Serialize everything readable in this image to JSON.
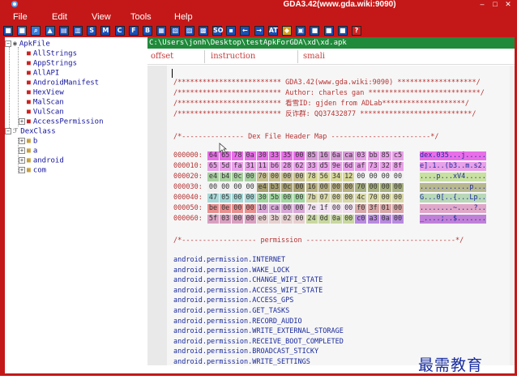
{
  "window": {
    "title": "GDA3.42(www.gda.wiki:9090)",
    "min_glyph": "–",
    "max_glyph": "□",
    "close_glyph": "✕"
  },
  "menu": [
    "File",
    "Edit",
    "View",
    "Tools",
    "Help"
  ],
  "toolbar": {
    "buttons": [
      {
        "glyph": "■",
        "color": "#1a4fb8"
      },
      {
        "glyph": "■",
        "color": "#3a7ad8"
      },
      {
        "glyph": "⌕",
        "color": "#3a7ad8"
      },
      {
        "glyph": "▲",
        "color": "#2a6ac8"
      },
      {
        "glyph": "▤",
        "color": "#1a4fb8"
      },
      {
        "glyph": "▥",
        "color": "#1a4fb8"
      },
      {
        "glyph": "S",
        "color": "#1a4fb8"
      },
      {
        "glyph": "M",
        "color": "#1a4fb8"
      },
      {
        "glyph": "C",
        "color": "#1a4fb8"
      },
      {
        "glyph": "F",
        "color": "#1a4fb8"
      },
      {
        "glyph": "B",
        "color": "#1a4fb8"
      },
      {
        "glyph": "▦",
        "color": "#1a4fb8"
      },
      {
        "glyph": "▧",
        "color": "#1a4fb8"
      },
      {
        "glyph": "▨",
        "color": "#1a4fb8"
      },
      {
        "glyph": "▩",
        "color": "#1a4fb8"
      },
      {
        "glyph": "SO",
        "color": "#1a4fb8"
      },
      {
        "glyph": "▪",
        "color": "#1a4fb8"
      },
      {
        "glyph": "←",
        "color": "#1a4fb8"
      },
      {
        "glyph": "→",
        "color": "#1a4fb8"
      },
      {
        "glyph": "AT",
        "color": "#1a4fb8"
      },
      {
        "glyph": "◆",
        "color": "#d8a018"
      },
      {
        "glyph": "▣",
        "color": "#1a4fb8"
      },
      {
        "glyph": "■",
        "color": "#1a4fb8"
      },
      {
        "glyph": "■",
        "color": "#1a4fb8"
      },
      {
        "glyph": "■",
        "color": "#1a4fb8"
      },
      {
        "glyph": "?",
        "color": "#d82020"
      }
    ]
  },
  "tree": {
    "root_apk": "ApkFile",
    "apk_children": [
      "AllStrings",
      "AppStrings",
      "AllAPI",
      "AndroidManifest",
      "HexView",
      "MalScan",
      "VulScan",
      "AccessPermission"
    ],
    "root_dex": "DexClass",
    "dex_children": [
      "b",
      "a",
      "android",
      "com"
    ]
  },
  "path": "C:\\Users\\jonh\\Desktop\\testApkForGDA\\xd\\xd.apk",
  "columns": {
    "offset": "offset",
    "instruction": "instruction",
    "smali": "smali"
  },
  "banner": [
    "/************************* GDA3.42(www.gda.wiki:9090) *******************/",
    "/************************* Author: charles gan ***************************/",
    "/************************* 看雪ID: gjden from ADLab********************/",
    "/************************* 反诈群: QQ37432877 ***************************/"
  ],
  "dex_header_title": "/*--------------- Dex File Header Map ------------------------*/",
  "hex": [
    {
      "addr": "000000:",
      "bytes": [
        "64",
        "65",
        "78",
        "0a",
        "30",
        "33",
        "35",
        "00",
        "85",
        "16",
        "6a",
        "ca",
        "03",
        "bb",
        "85",
        "c5"
      ],
      "colors": [
        "#e86ee8",
        "#e86ee8",
        "#e86ee8",
        "#e86ee8",
        "#e86ee8",
        "#e86ee8",
        "#e86ee8",
        "#e86ee8",
        "#d69ad6",
        "#d69ad6",
        "#d69ad6",
        "#d69ad6",
        "#e8a0e8",
        "#e8a0e8",
        "#e8a0e8",
        "#e8a0e8"
      ],
      "ascii": "dex.035...j.....",
      "ascii_color": "#e86ee8"
    },
    {
      "addr": "000010:",
      "bytes": [
        "65",
        "5d",
        "fa",
        "31",
        "11",
        "b6",
        "28",
        "62",
        "33",
        "d5",
        "9e",
        "6d",
        "af",
        "73",
        "32",
        "8f"
      ],
      "colors": [
        "#e8a0e8",
        "#e8a0e8",
        "#e8a0e8",
        "#e8a0e8",
        "#e8a0e8",
        "#e8a0e8",
        "#e8a0e8",
        "#e8a0e8",
        "#e8a0e8",
        "#e8a0e8",
        "#e8a0e8",
        "#e8a0e8",
        "#e8a0e8",
        "#e8a0e8",
        "#e8a0e8",
        "#e8a0e8"
      ],
      "ascii": "e].1..(b3..m.s2.",
      "ascii_color": "#e8a0e8"
    },
    {
      "addr": "000020:",
      "bytes": [
        "e4",
        "b4",
        "0c",
        "00",
        "70",
        "00",
        "00",
        "00",
        "78",
        "56",
        "34",
        "12",
        "00",
        "00",
        "00",
        "00"
      ],
      "colors": [
        "#a8d0a0",
        "#a8d0a0",
        "#a8d0a0",
        "#a8d0a0",
        "#c8c090",
        "#c8c090",
        "#c8c090",
        "#c8c090",
        "#d8d898",
        "#d8d898",
        "#d8d898",
        "#d8d898",
        "#f0f0f0",
        "#f0f0f0",
        "#f0f0f0",
        "#f0f0f0"
      ],
      "ascii": "....p...xV4.....",
      "ascii_color": "#c8e0a0"
    },
    {
      "addr": "000030:",
      "bytes": [
        "00",
        "00",
        "00",
        "00",
        "e4",
        "b3",
        "0c",
        "00",
        "16",
        "00",
        "00",
        "00",
        "70",
        "00",
        "00",
        "00"
      ],
      "colors": [
        "#f0f0f0",
        "#f0f0f0",
        "#f0f0f0",
        "#f0f0f0",
        "#a8a070",
        "#a8a070",
        "#a8a070",
        "#a8a070",
        "#b8b080",
        "#b8b080",
        "#b8b080",
        "#b8b080",
        "#a8b080",
        "#a8b080",
        "#a8b080",
        "#a8b080"
      ],
      "ascii": "............p...",
      "ascii_color": "#b8b890"
    },
    {
      "addr": "000040:",
      "bytes": [
        "47",
        "05",
        "00",
        "00",
        "30",
        "5b",
        "00",
        "00",
        "7b",
        "07",
        "00",
        "00",
        "4c",
        "70",
        "00",
        "00"
      ],
      "colors": [
        "#a8d8d8",
        "#a8d8d8",
        "#a8d8d8",
        "#a8d8d8",
        "#a0d8a0",
        "#a0d8a0",
        "#a0d8a0",
        "#a0d8a0",
        "#d8d8a8",
        "#d8d8a8",
        "#d8d8a8",
        "#d8d8a8",
        "#d8d8a8",
        "#d8d8a8",
        "#d8d8a8",
        "#d8d8a8"
      ],
      "ascii": "G...0[..{...Lp..",
      "ascii_color": "#b8d8b8"
    },
    {
      "addr": "000050:",
      "bytes": [
        "be",
        "0e",
        "00",
        "00",
        "10",
        "ca",
        "00",
        "00",
        "7e",
        "1f",
        "00",
        "00",
        "f0",
        "3f",
        "01",
        "00"
      ],
      "colors": [
        "#e89090",
        "#e89090",
        "#e89090",
        "#e89090",
        "#d8a8d8",
        "#d8a8d8",
        "#d8a8d8",
        "#d8a8d8",
        "#f0e0f0",
        "#f0e0f0",
        "#f0e0f0",
        "#f0e0f0",
        "#d8a8a8",
        "#d8a8a8",
        "#d8a8a8",
        "#d8a8a8"
      ],
      "ascii": "........~....?..",
      "ascii_color": "#e0a8c8"
    },
    {
      "addr": "000060:",
      "bytes": [
        "5f",
        "03",
        "00",
        "00",
        "e0",
        "3b",
        "02",
        "00",
        "24",
        "0d",
        "0a",
        "00",
        "c0",
        "a3",
        "0a",
        "00"
      ],
      "colors": [
        "#d8a0c0",
        "#d8a0c0",
        "#d8a0c0",
        "#d8a0c0",
        "#e8d0d0",
        "#e8d0d0",
        "#e8d0d0",
        "#e8d0d0",
        "#c8d8a0",
        "#c8d8a0",
        "#c8d8a0",
        "#c8d8a0",
        "#b88ae0",
        "#b88ae0",
        "#b88ae0",
        "#b88ae0"
      ],
      "ascii": "_....;..$.......",
      "ascii_color": "#c080d8"
    }
  ],
  "permission_title": "/*------------------ permission ------------------------------------*/",
  "permissions": [
    "android.permission.INTERNET",
    "android.permission.WAKE_LOCK",
    "android.permission.CHANGE_WIFI_STATE",
    "android.permission.ACCESS_WIFI_STATE",
    "android.permission.ACCESS_GPS",
    "android.permission.GET_TASKS",
    "android.permission.RECORD_AUDIO",
    "android.permission.WRITE_EXTERNAL_STORAGE",
    "android.permission.RECEIVE_BOOT_COMPLETED",
    "android.permission.BROADCAST_STICKY",
    "android.permission.WRITE_SETTINGS"
  ],
  "watermark": "最需教育",
  "colors": {
    "frame": "#c41818",
    "path_bar": "#1f8a3a",
    "tree_text": "#14149c",
    "comment": "#b83232",
    "perm": "#1a2a9c"
  }
}
